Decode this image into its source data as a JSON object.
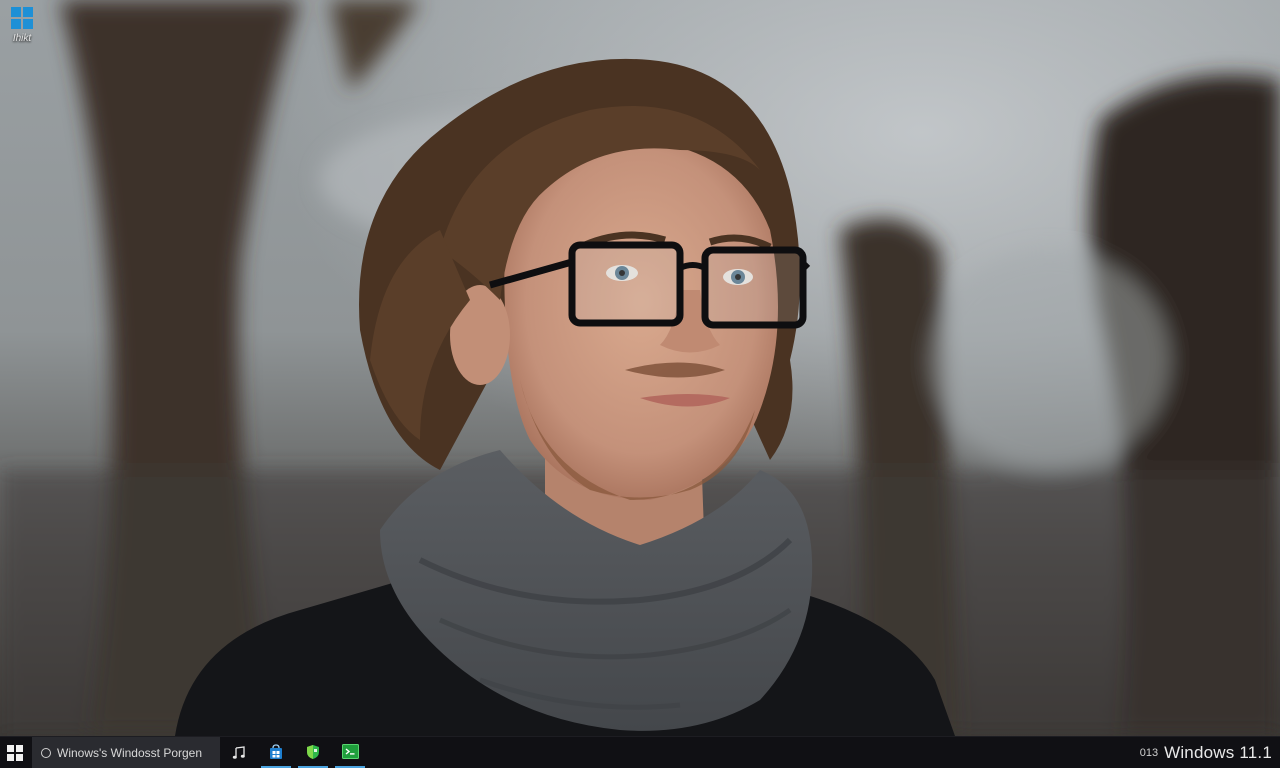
{
  "desktop": {
    "icon": {
      "label": "Ihikt",
      "icon": "windows-logo-icon"
    }
  },
  "taskbar": {
    "start": {
      "icon": "windows-logo-icon"
    },
    "search": {
      "text": "Winows's Windosst Porgen",
      "icon": "search-icon"
    },
    "pinned": [
      {
        "name": "music",
        "icon": "music-note-icon",
        "running": false
      },
      {
        "name": "store",
        "icon": "store-icon",
        "running": true
      },
      {
        "name": "shield",
        "icon": "shield-icon",
        "running": true
      },
      {
        "name": "terminal",
        "icon": "terminal-icon",
        "running": true
      }
    ],
    "tray": {
      "time": "013",
      "os_label": "Windows 11.1"
    }
  },
  "colors": {
    "taskbar_bg": "#101014",
    "search_bg": "#2a2b30",
    "accent_blue": "#1e90d6",
    "accent_green": "#2fb84a"
  }
}
